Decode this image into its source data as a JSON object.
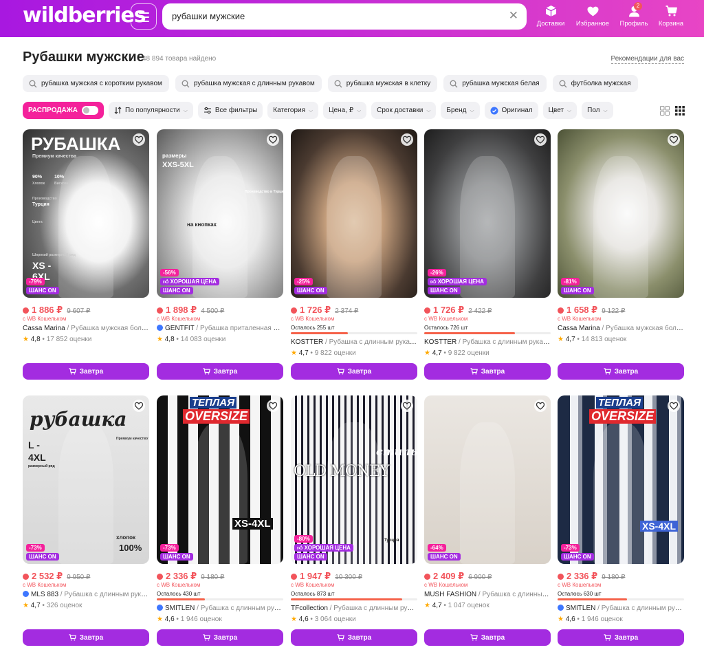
{
  "header": {
    "logo": "wildberries",
    "search_value": "рубашки мужские",
    "nav": [
      {
        "label": "Доставки",
        "icon": "box-icon"
      },
      {
        "label": "Избранное",
        "icon": "heart-icon"
      },
      {
        "label": "Профиль",
        "icon": "profile-icon",
        "badge": "2"
      },
      {
        "label": "Корзина",
        "icon": "cart-icon"
      }
    ]
  },
  "page": {
    "title": "Рубашки мужские",
    "found": "48 894 товара найдено",
    "recommendations": "Рекомендации для вас"
  },
  "suggestions": [
    "рубашка мужская с коротким рукавом",
    "рубашка мужская с длинным рукавом",
    "рубашка мужская в клетку",
    "рубашка мужская белая",
    "футболка мужская"
  ],
  "filters": {
    "sale": "РАСПРОДАЖА",
    "sort": "По популярности",
    "all": "Все фильтры",
    "items": [
      "Категория",
      "Цена, ₽",
      "Срок доставки",
      "Бренд"
    ],
    "original": "Оригинал",
    "items2": [
      "Цвет",
      "Пол"
    ]
  },
  "colors": {
    "accent": "#a32ce0",
    "sale_pink": "#f4219b",
    "price_red": "#f2545b",
    "rating_star": "#ffa900"
  },
  "products": [
    {
      "price": "1 886 ₽",
      "old": "9 607 ₽",
      "wallet": "с WB Кошельком",
      "brand": "Cassa Marina",
      "name": "Рубашка мужская больш...",
      "verified": false,
      "rating": "4,8",
      "reviews": "17 852 оценки",
      "discount": "-79%",
      "good_price": false,
      "chance": "ШАНС ON",
      "remain": null,
      "remain_fill": null,
      "cta": "Завтра",
      "photo_texts": [
        "РУБАШКА",
        "Премиум качества",
        "90%",
        "10%",
        "Хлопок",
        "Вискоза",
        "Производство",
        "Турция",
        "Цвета",
        "Широкий размерный ряд",
        "XS -",
        "6XL"
      ]
    },
    {
      "price": "1 898 ₽",
      "old": "4 500 ₽",
      "wallet": "с WB Кошельком",
      "brand": "GENTFIT",
      "name": "Рубашка приталенная на к...",
      "verified": true,
      "rating": "4,8",
      "reviews": "14 083 оценки",
      "discount": "-56%",
      "good_price": true,
      "good_label": "ХОРОШАЯ ЦЕНА",
      "chance": "ШАНС ON",
      "remain": null,
      "remain_fill": null,
      "cta": "Завтра",
      "photo_texts": [
        "размеры",
        "XXS-5XL",
        "на кнопках",
        "Производство в Турции"
      ]
    },
    {
      "price": "1 726 ₽",
      "old": "2 374 ₽",
      "wallet": "с WB Кошельком",
      "brand": "KOSTTER",
      "name": "Рубашка с длинным рукаво...",
      "verified": false,
      "rating": "4,7",
      "reviews": "9 822 оценки",
      "discount": "-25%",
      "good_price": false,
      "chance": "ШАНС ON",
      "remain": "Осталось 255 шт",
      "remain_fill": 0.45,
      "cta": "Завтра",
      "photo_texts": []
    },
    {
      "price": "1 726 ₽",
      "old": "2 422 ₽",
      "wallet": "с WB Кошельком",
      "brand": "KOSTTER",
      "name": "Рубашка с длинным рукаво...",
      "verified": false,
      "rating": "4,7",
      "reviews": "9 822 оценки",
      "discount": "-26%",
      "good_price": true,
      "good_label": "ХОРОШАЯ ЦЕНА",
      "chance": "ШАНС ON",
      "remain": "Осталось 726 шт",
      "remain_fill": 0.72,
      "cta": "Завтра",
      "photo_texts": []
    },
    {
      "price": "1 658 ₽",
      "old": "9 122 ₽",
      "wallet": "с WB Кошельком",
      "brand": "Cassa Marina",
      "name": "Рубашка мужская больш...",
      "verified": false,
      "rating": "4,7",
      "reviews": "14 813 оценок",
      "discount": "-81%",
      "good_price": false,
      "chance": "ШАНС ON",
      "remain": null,
      "remain_fill": null,
      "cta": "Завтра",
      "photo_texts": []
    },
    {
      "price": "2 532 ₽",
      "old": "9 950 ₽",
      "wallet": "с WB Кошельком",
      "brand": "MLS 883",
      "name": "Рубашка с длинным рукав...",
      "verified": true,
      "rating": "4,7",
      "reviews": "326 оценок",
      "discount": "-73%",
      "good_price": false,
      "chance": "ШАНС ON",
      "remain": null,
      "remain_fill": null,
      "cta": "Завтра",
      "photo_texts": [
        "рубашка",
        "L -",
        "4XL",
        "размерный ряд",
        "Премиум качество ткани",
        "хлопок",
        "100%"
      ]
    },
    {
      "price": "2 336 ₽",
      "old": "9 180 ₽",
      "wallet": "с WB Кошельком",
      "brand": "SMITLEN",
      "name": "Рубашка с длинным рукав...",
      "verified": true,
      "rating": "4,6",
      "reviews": "1 946 оценок",
      "discount": "-73%",
      "good_price": false,
      "chance": "ШАНС ON",
      "remain": "Осталось 430 шт",
      "remain_fill": 0.38,
      "cta": "Завтра",
      "photo_texts": [
        "ТЕПЛАЯ",
        "OVERSIZE",
        "XS-4XL"
      ]
    },
    {
      "price": "1 947 ₽",
      "old": "10 300 ₽",
      "wallet": "с WB Кошельком",
      "brand": "TFcollection",
      "name": "Рубашка с длинным рукав...",
      "verified": false,
      "rating": "4,6",
      "reviews": "3 064 оценки",
      "discount": "-80%",
      "good_price": true,
      "good_label": "ХОРОШАЯ ЦЕНА",
      "chance": "ШАНС ON",
      "remain": "Осталось 873 шт",
      "remain_fill": 0.88,
      "cta": "Завтра",
      "photo_texts": [
        "стиль",
        "OLD MONEY",
        "Турция"
      ]
    },
    {
      "price": "2 409 ₽",
      "old": "6 900 ₽",
      "wallet": "с WB Кошельком",
      "brand": "MUSH FASHION",
      "name": "Рубашка с длинным ру...",
      "verified": false,
      "rating": "4,7",
      "reviews": "1 047 оценок",
      "discount": "-64%",
      "good_price": false,
      "chance": "ШАНС ON",
      "remain": null,
      "remain_fill": null,
      "cta": "Завтра",
      "photo_texts": []
    },
    {
      "price": "2 336 ₽",
      "old": "9 180 ₽",
      "wallet": "с WB Кошельком",
      "brand": "SMITLEN",
      "name": "Рубашка с длинным рукав...",
      "verified": true,
      "rating": "4,6",
      "reviews": "1 946 оценок",
      "discount": "-73%",
      "good_price": false,
      "chance": "ШАНС ON",
      "remain": "Осталось 630 шт",
      "remain_fill": 0.55,
      "cta": "Завтра",
      "photo_texts": [
        "ТЕПЛАЯ",
        "OVERSIZE",
        "XS-4XL"
      ]
    }
  ]
}
